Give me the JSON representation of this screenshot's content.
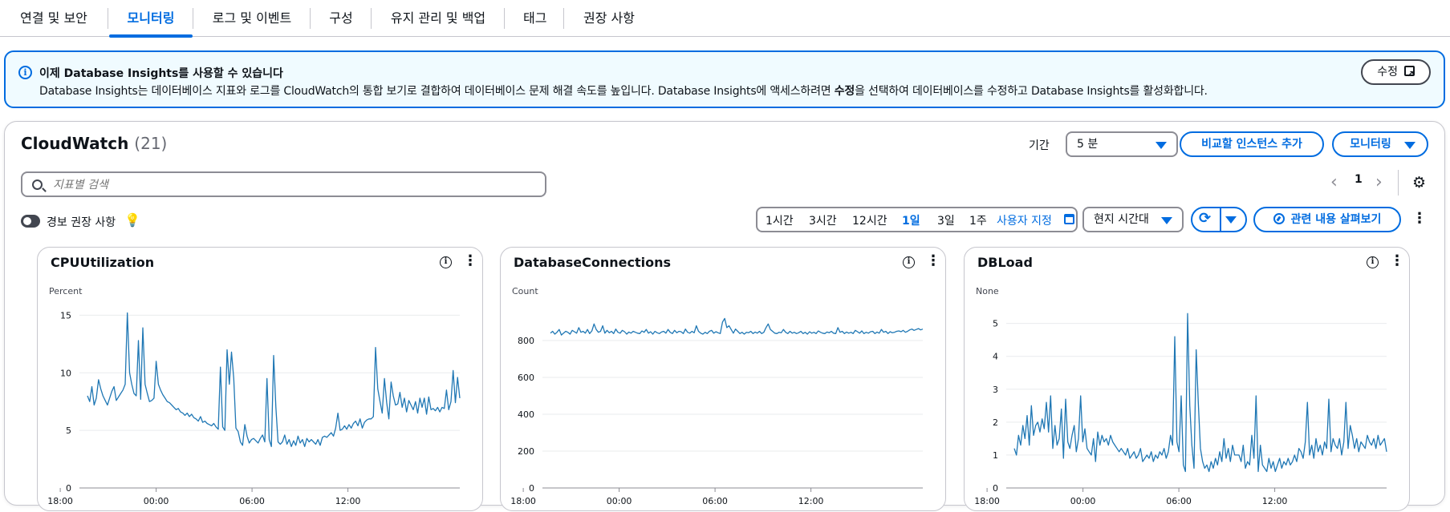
{
  "tabs": [
    {
      "label": "연결 및 보안",
      "active": false
    },
    {
      "label": "모니터링",
      "active": true
    },
    {
      "label": "로그 및 이벤트",
      "active": false
    },
    {
      "label": "구성",
      "active": false
    },
    {
      "label": "유지 관리 및 백업",
      "active": false
    },
    {
      "label": "태그",
      "active": false
    },
    {
      "label": "권장 사항",
      "active": false
    }
  ],
  "banner": {
    "title": "이제 Database Insights를 사용할 수 있습니다",
    "body_pre": "Database Insights는 데이터베이스 지표와 로그를 CloudWatch의 통합 보기로 결합하여 데이터베이스 문제 해결 속도를 높입니다. Database Insights에 액세스하려면 ",
    "body_bold": "수정",
    "body_post": "을 선택하여 데이터베이스를 수정하고 Database Insights를 활성화합니다.",
    "edit_label": "수정"
  },
  "cloudwatch": {
    "title": "CloudWatch",
    "count": "(21)",
    "period_label": "기간",
    "period_value": "5 분",
    "compare_button": "비교할 인스턴스 추가",
    "monitoring_button": "모니터링",
    "search_placeholder": "지표별 검색",
    "page": "1",
    "alarm_toggle_label": "경보 권장 사항",
    "time_ranges": [
      "1시간",
      "3시간",
      "12시간",
      "1일",
      "3일",
      "1주"
    ],
    "selected_range": "1일",
    "custom_range": "사용자 지정",
    "timezone": "현지 시간대",
    "browse_related": "관련 내용 살펴보기"
  },
  "colors": {
    "accent": "#006ce0",
    "series": "#1f77b4"
  },
  "chart_data": [
    {
      "type": "line",
      "title": "CPUUtilization",
      "ylabel": "Percent",
      "ylim": [
        0,
        16
      ],
      "yticks": [
        0,
        5,
        10,
        15
      ],
      "xticks": [
        "18:00",
        "00:00",
        "06:00",
        "12:00"
      ],
      "xrange_hours": [
        -4.8,
        19
      ],
      "series": [
        {
          "values": [
            8,
            7.5,
            8.8,
            7.2,
            7.8,
            9.4,
            8.6,
            8,
            7.6,
            7.2,
            7.8,
            8.4,
            8.8,
            7.6,
            7.9,
            8.2,
            8.5,
            9,
            15.2,
            10,
            9,
            8.2,
            8,
            12.8,
            7.7,
            13.9,
            9,
            8.2,
            7.5,
            7.6,
            7.8,
            11,
            9,
            8.5,
            8.1,
            7.8,
            7.5,
            7.4,
            7.2,
            7,
            6.8,
            6.9,
            6.6,
            6.5,
            6.3,
            6.5,
            6.2,
            6.4,
            6.1,
            6,
            5.8,
            6.2,
            5.7,
            5.8,
            5.6,
            5.5,
            5.4,
            5.6,
            5.3,
            5.1,
            10.5,
            5.3,
            5,
            12,
            9,
            11.8,
            9.5,
            5.2,
            4.9,
            4,
            3.7,
            5.5,
            4.5,
            3.9,
            4.2,
            4.3,
            4.1,
            3.9,
            4.3,
            4.6,
            4,
            9.5,
            4.2,
            3.6,
            11.5,
            7,
            4,
            3.8,
            4,
            4.6,
            3.8,
            4.2,
            3.6,
            4.1,
            3.7,
            4.5,
            3.9,
            4.2,
            3.6,
            4.3,
            4,
            4.2,
            4,
            3.8,
            4.2,
            3.7,
            4.4,
            4.5,
            4.4,
            4.6,
            4.8,
            4.5,
            5.2,
            6.5,
            5,
            5.1,
            5.4,
            5.1,
            5.5,
            5.2,
            5.6,
            5.8,
            5.4,
            6,
            5.2,
            5.7,
            5.9,
            6,
            6,
            6.2,
            12.2,
            8.6,
            7.5,
            6.5,
            9.5,
            7.4,
            6,
            9.2,
            8,
            7.2,
            7.3,
            8.3,
            7,
            7.8,
            6.6,
            7.6,
            7.2,
            6.8,
            7.5,
            6.5,
            7.8,
            7,
            7.8,
            6.4,
            7.9,
            6.8,
            6.9,
            6.7,
            7,
            6.6,
            7,
            6.9,
            8.5,
            6.8,
            7.5,
            10.2,
            7.4,
            9.6,
            7.8
          ]
        }
      ]
    },
    {
      "type": "line",
      "title": "DatabaseConnections",
      "ylabel": "Count",
      "ylim": [
        0,
        1000
      ],
      "yticks": [
        0,
        200,
        400,
        600,
        800
      ],
      "xticks": [
        "18:00",
        "00:00",
        "06:00",
        "12:00"
      ],
      "xrange_hours": [
        -4.8,
        19
      ],
      "series": [
        {
          "values": [
            840,
            850,
            835,
            845,
            860,
            830,
            840,
            850,
            845,
            835,
            855,
            848,
            840,
            870,
            845,
            850,
            840,
            860,
            838,
            852,
            890,
            860,
            845,
            850,
            880,
            840,
            855,
            842,
            850,
            838,
            862,
            845,
            840,
            855,
            848,
            835,
            846,
            840,
            850,
            845,
            840,
            838,
            852,
            845,
            860,
            840,
            848,
            835,
            850,
            842,
            838,
            846,
            850,
            840,
            860,
            845,
            838,
            855,
            842,
            850,
            848,
            838,
            862,
            845,
            840,
            850,
            842,
            880,
            850,
            840,
            835,
            845,
            838,
            850,
            855,
            840,
            848,
            842,
            838,
            900,
            920,
            870,
            880,
            860,
            840,
            862,
            850,
            838,
            845,
            835,
            845,
            842,
            850,
            838,
            846,
            840,
            850,
            838,
            845,
            870,
            890,
            860,
            850,
            840,
            838,
            845,
            842,
            860,
            845,
            838,
            850,
            840,
            845,
            838,
            842,
            850,
            838,
            845,
            835,
            848,
            840,
            845,
            838,
            852,
            845,
            840,
            838,
            846,
            842,
            850,
            840,
            838,
            870,
            845,
            850,
            838,
            846,
            840,
            845,
            838,
            855,
            848,
            840,
            852,
            838,
            845,
            840,
            848,
            850,
            838,
            846,
            840,
            860,
            845,
            850,
            838,
            848,
            842,
            845,
            850,
            852,
            848,
            855,
            845,
            850,
            858,
            862,
            855,
            860,
            865,
            858,
            862
          ]
        }
      ]
    },
    {
      "type": "line",
      "title": "DBLoad",
      "ylabel": "None",
      "ylim": [
        0,
        5.6
      ],
      "yticks": [
        0,
        1,
        2,
        3,
        4,
        5
      ],
      "xticks": [
        "18:00",
        "00:00",
        "06:00",
        "12:00"
      ],
      "xrange_hours": [
        -4.8,
        19
      ],
      "series": [
        {
          "values": [
            1.2,
            1,
            1.6,
            1.3,
            1.9,
            1.5,
            2.2,
            1.3,
            2.5,
            1.6,
            1.9,
            2,
            1.7,
            2.1,
            1.8,
            2.6,
            1.7,
            2.8,
            1.2,
            1.9,
            1.3,
            1.5,
            2.4,
            0.9,
            2.7,
            1.4,
            1.2,
            1.6,
            1.9,
            1.1,
            1.5,
            2.8,
            1.4,
            1.8,
            1.2,
            1.1,
            1,
            1.5,
            0.8,
            1.7,
            1.3,
            1.6,
            1.4,
            1.5,
            1.3,
            1.6,
            1.4,
            1.3,
            1.2,
            1.1,
            1.2,
            1.1,
            1,
            1.2,
            0.9,
            1,
            1.1,
            0.9,
            1,
            1.2,
            0.8,
            0.9,
            1,
            0.9,
            1.1,
            0.8,
            1,
            0.9,
            1.1,
            1,
            1.2,
            0.9,
            1.1,
            1.6,
            1.3,
            4.6,
            1.4,
            1.1,
            2.8,
            0.7,
            0.5,
            5.3,
            2.5,
            1.3,
            0.6,
            4.2,
            2.6,
            1.2,
            0.8,
            0.6,
            0.7,
            0.5,
            0.8,
            0.6,
            0.9,
            0.7,
            1.1,
            0.8,
            1.5,
            0.9,
            1.2,
            0.8,
            1.3,
            1,
            1,
            1,
            0.8,
            1.3,
            0.6,
            0.8,
            0.7,
            1.6,
            0.9,
            2.8,
            0.5,
            1.3,
            0.7,
            0.6,
            0.5,
            0.9,
            0.6,
            0.8,
            0.5,
            0.7,
            0.9,
            0.6,
            0.8,
            0.7,
            0.9,
            0.7,
            0.8,
            1,
            0.8,
            1.2,
            1.1,
            0.9,
            1.4,
            2.6,
            1,
            1.3,
            0.9,
            1.5,
            1.1,
            1.3,
            1,
            1.4,
            1.2,
            2.7,
            1.1,
            1.5,
            1.3,
            1.2,
            1.5,
            1,
            1.4,
            2.6,
            1.2,
            1.9,
            1.6,
            1.2,
            1.5,
            1.1,
            1.4,
            1.3,
            1.2,
            1.6,
            1.4,
            1.3,
            1.5,
            1.2,
            1.6,
            1.3,
            1.4,
            1.5,
            1.1
          ]
        }
      ]
    }
  ]
}
